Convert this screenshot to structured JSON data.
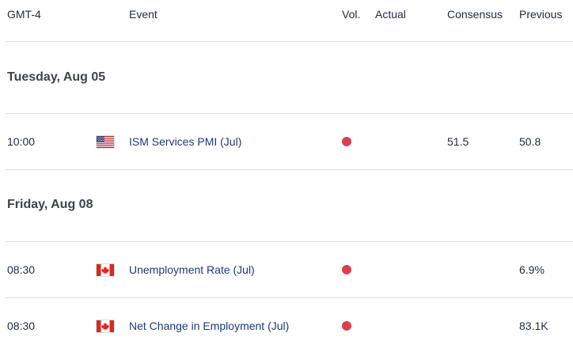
{
  "header": {
    "timezone": "GMT-4",
    "event": "Event",
    "vol": "Vol.",
    "actual": "Actual",
    "consensus": "Consensus",
    "previous": "Previous"
  },
  "groups": [
    {
      "date": "Tuesday, Aug 05",
      "events": [
        {
          "time": "10:00",
          "country_flag": "us-flag-icon",
          "name": "ISM Services PMI (Jul)",
          "volatility": "high",
          "actual": "",
          "consensus": "51.5",
          "previous": "50.8"
        }
      ]
    },
    {
      "date": "Friday, Aug 08",
      "events": [
        {
          "time": "08:30",
          "country_flag": "canada-flag-icon",
          "name": "Unemployment Rate (Jul)",
          "volatility": "high",
          "actual": "",
          "consensus": "",
          "previous": "6.9%"
        },
        {
          "time": "08:30",
          "country_flag": "canada-flag-icon",
          "name": "Net Change in Employment (Jul)",
          "volatility": "high",
          "actual": "",
          "consensus": "",
          "previous": "83.1K"
        }
      ]
    }
  ],
  "colors": {
    "volatility_high": "#d9404f",
    "event_text": "#1d3a78",
    "divider": "#d9dde3"
  }
}
